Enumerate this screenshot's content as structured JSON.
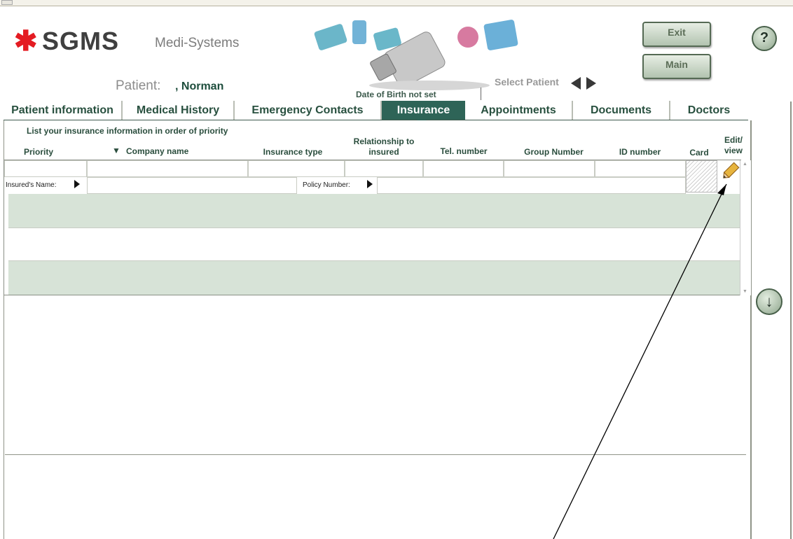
{
  "app": {
    "logo_mark": "✱",
    "logo_text": "SGMS",
    "brand": "Medi-Systems"
  },
  "patient": {
    "label": "Patient:",
    "name": ", Norman",
    "dob": "Date of Birth not set",
    "select_label": "Select Patient"
  },
  "buttons": {
    "exit": "Exit",
    "main": "Main",
    "help": "?",
    "scroll_down": "↓"
  },
  "tabs": [
    {
      "label": "Patient information"
    },
    {
      "label": "Medical History"
    },
    {
      "label": "Emergency Contacts"
    },
    {
      "label": "Insurance"
    },
    {
      "label": "Appointments"
    },
    {
      "label": "Documents"
    },
    {
      "label": "Doctors"
    }
  ],
  "active_tab": "Insurance",
  "insurance": {
    "hint": "List your insurance information in order of priority",
    "sort_indicator": "▼",
    "columns": {
      "priority": "Priority",
      "company": "Company name",
      "type": "Insurance type",
      "relationship": "Relationship to insured",
      "tel": "Tel. number",
      "group": "Group Number",
      "id": "ID number",
      "card": "Card",
      "edit": "Edit/ view"
    },
    "insured_name_label": "Insured's Name:",
    "policy_number_label": "Policy Number:",
    "row_values": {
      "priority": "",
      "company": "",
      "type": "",
      "relationship": "",
      "tel": "",
      "group": "",
      "id": "",
      "insured_name": "",
      "policy_number": ""
    }
  },
  "colors": {
    "accent": "#2e6457",
    "band_green": "#d7e3d7",
    "logo_red": "#e41b22"
  }
}
